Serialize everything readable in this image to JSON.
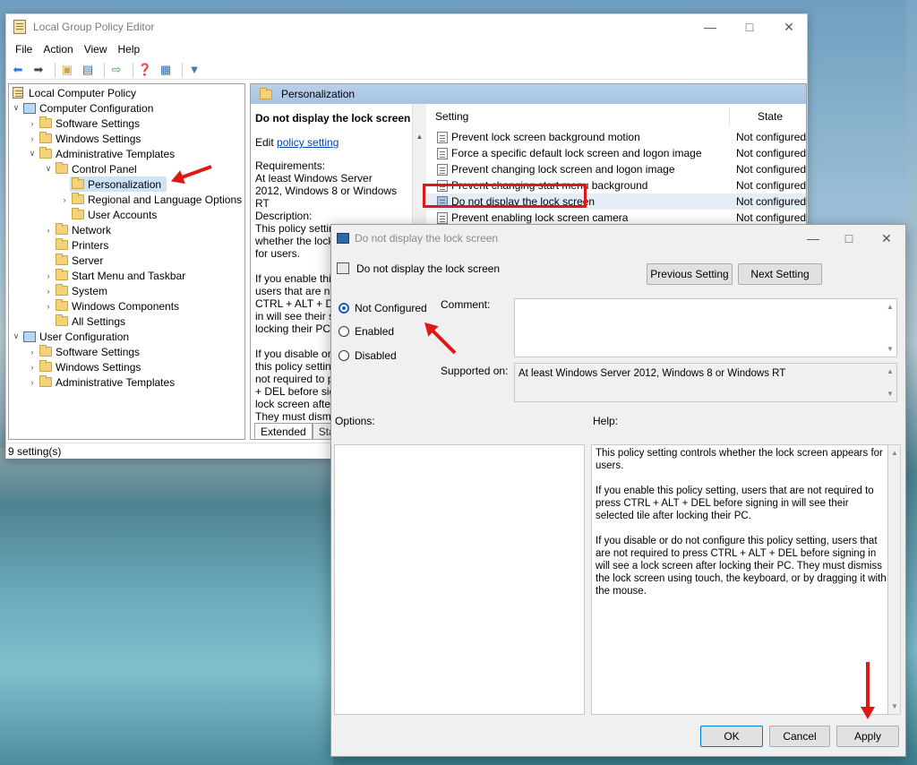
{
  "window": {
    "title": "Local Group Policy Editor",
    "menu": [
      "File",
      "Action",
      "View",
      "Help"
    ],
    "status": "9 setting(s)"
  },
  "tree": {
    "items": [
      {
        "label": "Local Computer Policy"
      },
      {
        "label": "Computer Configuration"
      },
      {
        "label": "Software Settings"
      },
      {
        "label": "Windows Settings"
      },
      {
        "label": "Administrative Templates"
      },
      {
        "label": "Control Panel"
      },
      {
        "label": "Personalization"
      },
      {
        "label": "Regional and Language Options"
      },
      {
        "label": "User Accounts"
      },
      {
        "label": "Network"
      },
      {
        "label": "Printers"
      },
      {
        "label": "Server"
      },
      {
        "label": "Start Menu and Taskbar"
      },
      {
        "label": "System"
      },
      {
        "label": "Windows Components"
      },
      {
        "label": "All Settings"
      },
      {
        "label": "User Configuration"
      },
      {
        "label": "Software Settings"
      },
      {
        "label": "Windows Settings"
      },
      {
        "label": "Administrative Templates"
      }
    ]
  },
  "pane": {
    "header": "Personalization",
    "ext_title": "Do not display the lock screen",
    "edit_prefix": "Edit",
    "edit_link": "policy setting",
    "requirements_label": "Requirements:",
    "requirements_text": "At least Windows Server 2012, Windows 8 or Windows RT",
    "description_label": "Description:",
    "description_lines": [
      "This policy setting",
      "whether the lock",
      "for users.",
      "",
      "If you enable this",
      "users that are not",
      "CTRL + ALT + DEL",
      "in will see their se",
      "locking their PC.",
      "",
      "If you disable or d",
      "this policy setting",
      "not required to pre",
      "+ DEL before sign",
      "lock screen after l",
      "They must dismis"
    ],
    "tabs": [
      "Extended",
      "Standard"
    ],
    "columns": {
      "setting": "Setting",
      "state": "State"
    },
    "rows": [
      {
        "name": "Prevent lock screen background motion",
        "state": "Not configured"
      },
      {
        "name": "Force a specific default lock screen and logon image",
        "state": "Not configured"
      },
      {
        "name": "Prevent changing lock screen and logon image",
        "state": "Not configured"
      },
      {
        "name": "Prevent changing start menu background",
        "state": "Not configured"
      },
      {
        "name": "Do not display the lock screen",
        "state": "Not configured"
      },
      {
        "name": "Prevent enabling lock screen camera",
        "state": "Not configured"
      }
    ]
  },
  "dialog": {
    "title": "Do not display the lock screen",
    "heading": "Do not display the lock screen",
    "prev_btn": "Previous Setting",
    "next_btn": "Next Setting",
    "radios": [
      {
        "label": "Not Configured",
        "checked": true
      },
      {
        "label": "Enabled",
        "checked": false
      },
      {
        "label": "Disabled",
        "checked": false
      }
    ],
    "comment_label": "Comment:",
    "supported_label": "Supported on:",
    "supported_value": "At least Windows Server 2012, Windows 8 or Windows RT",
    "options_label": "Options:",
    "help_label": "Help:",
    "help_paragraphs": [
      "This policy setting controls whether the lock screen appears for users.",
      "If you enable this policy setting, users that are not required to press CTRL + ALT + DEL before signing in will see their selected tile after locking their PC.",
      "If you disable or do not configure this policy setting, users that are not required to press CTRL + ALT + DEL before signing in will see a lock screen after locking their PC. They must dismiss the lock screen using touch, the keyboard, or by dragging it with the mouse."
    ],
    "ok_btn": "OK",
    "cancel_btn": "Cancel",
    "apply_btn": "Apply"
  },
  "colors": {
    "annotation": "#e01717",
    "selection": "#cce4f7",
    "pane_header": "#b9d1ea"
  }
}
